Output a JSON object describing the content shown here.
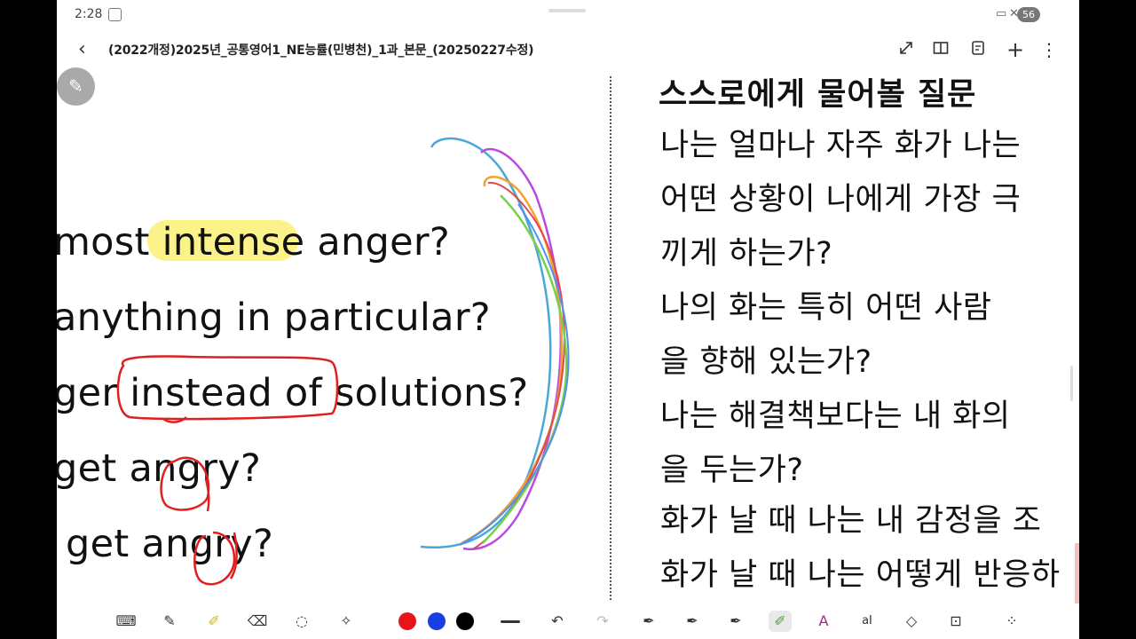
{
  "status_bar": {
    "time": "2:28",
    "battery": "56"
  },
  "title_bar": {
    "back_icon": "chevron-left-icon",
    "title": "(2022개정)2025년_공통영어1_NE능률(민병천)_1과_본문_(20250227수정)"
  },
  "english_lines": [
    "most intense anger?",
    "anything in particular?",
    "ger instead of solutions?",
    "get angry?",
    " get angry?"
  ],
  "korean": {
    "heading": "스스로에게 물어볼 질문",
    "lines": [
      "나는 얼마나 자주 화가 나는",
      "어떤 상황이 나에게 가장 극",
      "끼게 하는가?",
      "나의 화는 특히 어떤 사람",
      "을 향해 있는가?",
      "나는 해결책보다는 내 화의",
      "을 두는가?",
      "화가 날 때 나는 내 감정을 조",
      "화가 날 때 나는 어떻게 반응하"
    ]
  },
  "toolbar": {
    "colors": {
      "red": "#e8141b",
      "blue": "#1a3fe0",
      "black": "#000000"
    },
    "tools": [
      "keyboard-icon",
      "pen-icon",
      "highlighter-icon",
      "eraser-icon",
      "lasso-icon",
      "sparkle-icon",
      "line-width-icon",
      "undo-icon",
      "redo-icon",
      "pen-style-1-icon",
      "pen-style-2-icon",
      "pen-style-3-icon",
      "highlighter-active-icon",
      "text-style-icon",
      "text-recognition-icon",
      "shape-icon",
      "lock-icon",
      "grid-icon"
    ]
  }
}
